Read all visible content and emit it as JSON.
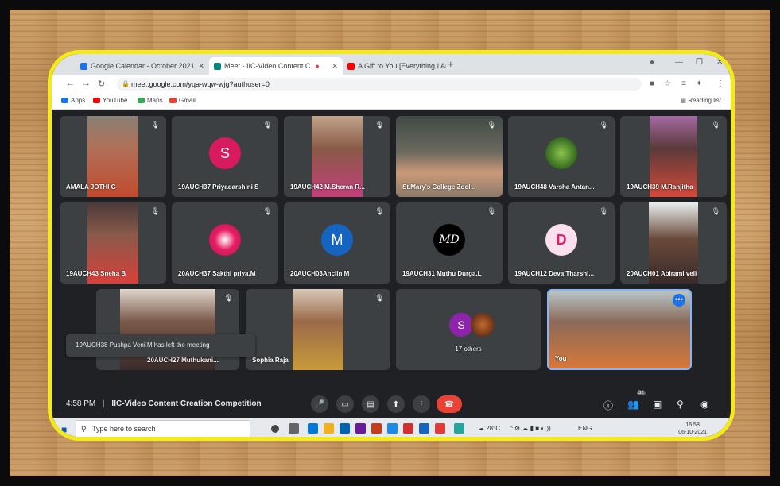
{
  "browser": {
    "tabs": [
      {
        "label": "Google Calendar - October 2021"
      },
      {
        "label": "Meet - IIC-Video Content C"
      },
      {
        "label": "A Gift to You [Everything I Am] -"
      }
    ],
    "url": "meet.google.com/yqa-wqw-wjg?authuser=0",
    "bookmarks": [
      {
        "label": "Apps"
      },
      {
        "label": "YouTube"
      },
      {
        "label": "Maps"
      },
      {
        "label": "Gmail"
      }
    ],
    "reading_list": "Reading list"
  },
  "meet": {
    "tiles": [
      {
        "name": "AMALA JOTHI G"
      },
      {
        "name": "19AUCH37 Priyadarshini S",
        "initial": "S"
      },
      {
        "name": "19AUCH42 M.Sheran R..."
      },
      {
        "name": "St.Mary's College Zool..."
      },
      {
        "name": "19AUCH48 Varsha Antan..."
      },
      {
        "name": "19AUCH39 M.Ranjitha"
      },
      {
        "name": "19AUCH43 Sneha B"
      },
      {
        "name": "20AUCH37 Sakthi priya.M"
      },
      {
        "name": "20AUCH03Anclin M",
        "initial": "M"
      },
      {
        "name": "19AUCH31 Muthu Durga.L",
        "initial": "MD"
      },
      {
        "name": "19AUCH12 Deva Tharshi...",
        "initial": "D"
      },
      {
        "name": "20AUCH01 Abirami veli"
      },
      {
        "name": "20AUCH27 Muthukani..."
      },
      {
        "name": "Sophia Raja"
      },
      {
        "name": "17 others",
        "initial": "S"
      },
      {
        "name": "You"
      }
    ],
    "toast": "19AUCH38 Pushpa Veni.M has left the meeting",
    "time": "4:58 PM",
    "meeting_title": "IIC-Video Content Creation Competition",
    "participant_count": "32"
  },
  "taskbar": {
    "search_placeholder": "Type here to search",
    "weather": "28°C",
    "language": "ENG",
    "time": "16:58",
    "date": "06-10-2021"
  }
}
